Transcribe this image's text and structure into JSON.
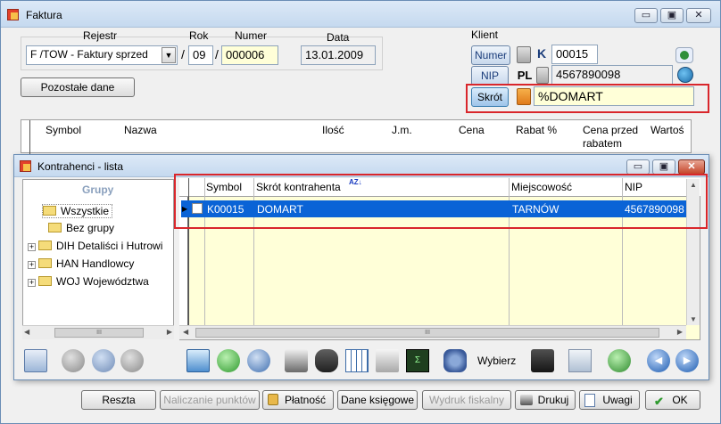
{
  "main_window": {
    "title": "Faktura",
    "minimize": "▭",
    "maximize": "▣",
    "close": "✕"
  },
  "header": {
    "rejestr_label": "Rejestr",
    "rejestr_value": "F /TOW - Faktury sprzed",
    "rok_label": "Rok",
    "rok_value": "09",
    "numer_label": "Numer",
    "numer_value": "000006",
    "data_label": "Data",
    "data_value": "13.01.2009",
    "slash1": "/",
    "slash2": "/",
    "pozostale_button": "Pozostałe dane"
  },
  "klient": {
    "label": "Klient",
    "numer_button": "Numer",
    "numer_prefix": "K",
    "numer_value": "00015",
    "nip_button": "NIP",
    "nip_prefix": "PL",
    "nip_value": "4567890098",
    "skrot_button": "Skrót",
    "skrot_value": "%DOMART"
  },
  "items_table": {
    "columns": [
      "Symbol",
      "Nazwa",
      "Ilość",
      "J.m.",
      "Cena",
      "Rabat %",
      "Cena przed rabatem",
      "Wartoś"
    ]
  },
  "contractors_window": {
    "title": "Kontrahenci - lista",
    "groups_header": "Grupy",
    "groups": [
      {
        "label": "Wszystkie",
        "expandable": false,
        "selected": true
      },
      {
        "label": "Bez grupy",
        "expandable": false,
        "selected": false
      },
      {
        "label": "DIH Detaliści i Hutrowi",
        "expandable": true,
        "selected": false
      },
      {
        "label": "HAN Handlowcy",
        "expandable": true,
        "selected": false
      },
      {
        "label": "WOJ Województwa",
        "expandable": true,
        "selected": false
      }
    ],
    "columns": {
      "symbol": "Symbol",
      "skrot": "Skrót kontrahenta",
      "miejscowosc": "Miejscowość",
      "nip": "NIP"
    },
    "sort_indicator": "AZ↓",
    "rows": [
      {
        "symbol": "K00015",
        "skrot": "DOMART",
        "miejscowosc": "TARNÓW",
        "nip": "4567890098"
      }
    ],
    "scroll_mid": "III",
    "wybierz_label": "Wybierz"
  },
  "bottom_bar": {
    "reszta": "Reszta",
    "naliczanie": "Naliczanie punktów",
    "platnosc": "Płatność",
    "dane_ksiegowe": "Dane księgowe",
    "wydruk_fiskalny": "Wydruk fiskalny",
    "drukuj": "Drukuj",
    "uwagi": "Uwagi",
    "ok": "OK"
  },
  "colors": {
    "selection": "#0a63d6",
    "highlight_box": "#d9262b",
    "row_fill": "#ffffd8",
    "accent_blue": "#1a3c7a"
  }
}
